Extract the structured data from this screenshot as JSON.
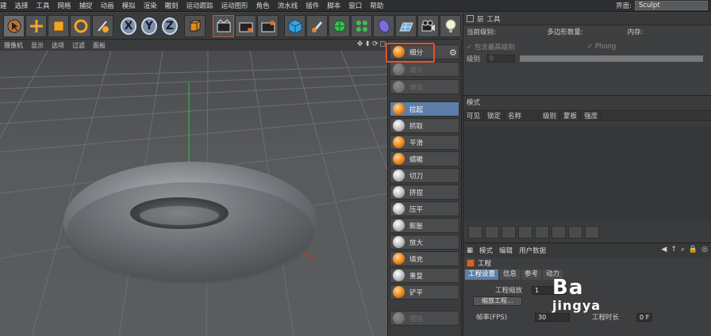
{
  "menubar": {
    "items": [
      "建",
      "选择",
      "工具",
      "网格",
      "捕捉",
      "动画",
      "模拟",
      "渲染",
      "雕刻",
      "运动跟踪",
      "运动图形",
      "角色",
      "流水线",
      "插件",
      "脚本",
      "窗口",
      "帮助"
    ],
    "layout_label": "界面:",
    "layout_value": "Sculpt"
  },
  "toolbar": {
    "xyz": [
      "X",
      "Y",
      "Z"
    ],
    "icons": [
      "pointer-icon",
      "move-icon",
      "scale-icon",
      "rotate-icon",
      "live-select-icon",
      "xyz-lock-icon",
      "coord-system-icon",
      "render-view-icon",
      "render-picture-icon",
      "render-settings-icon",
      "cube-icon",
      "pen-icon",
      "subdivision-icon",
      "cloner-icon",
      "deformer-icon",
      "floor-icon",
      "camera-icon",
      "light-icon"
    ]
  },
  "viewport": {
    "menu": [
      "摄像机",
      "显示",
      "选项",
      "过滤",
      "面板"
    ]
  },
  "sculpt": {
    "subdivide": "细分",
    "decrease": "减少",
    "increase": "增加",
    "tools": [
      "拉起",
      "抓取",
      "平滑",
      "蜡雕",
      "切刀",
      "挤捏",
      "压平",
      "膨胀",
      "放大",
      "填充",
      "重复",
      "铲平"
    ],
    "erase": "擦除"
  },
  "attr_top": {
    "tabs": [
      "层",
      "工具"
    ],
    "headers": [
      "当前级别:",
      "多边形数量:",
      "内存:"
    ],
    "check1": "包含最高级别",
    "check2": "Phong",
    "level_label": "级别",
    "level_value": "0"
  },
  "layers": {
    "title": "模式",
    "columns": [
      "可见",
      "锁定",
      "名称",
      "级别",
      "蒙板",
      "强度"
    ]
  },
  "attributes": {
    "menu": [
      "模式",
      "编辑",
      "用户数据"
    ],
    "object": "工程",
    "tabs": [
      "工程设置",
      "信息",
      "参考",
      "动力"
    ],
    "project_scale_label": "工程缩放",
    "project_scale_value": "1",
    "scale_button": "缩放工程...",
    "fps_label": "帧率(FPS)",
    "fps_value": "30",
    "project_time_label": "工程时长",
    "project_time_value": "0 F"
  },
  "watermark": {
    "line1": "Ba",
    "line2": "jingya"
  }
}
